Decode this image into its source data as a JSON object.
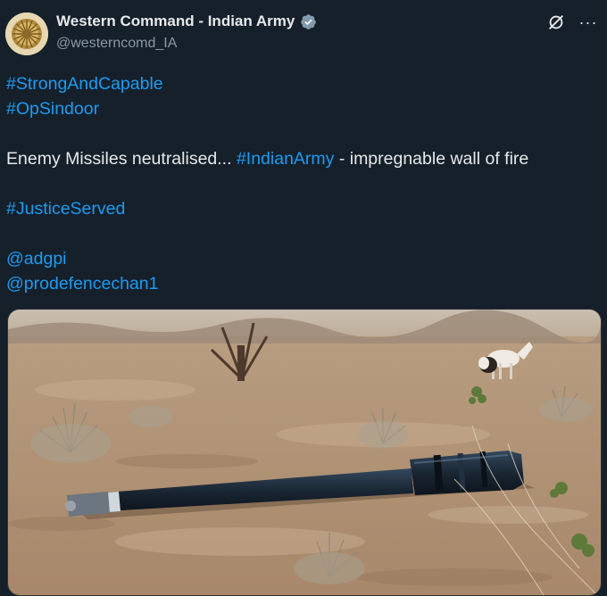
{
  "post": {
    "display_name": "Western Command - Indian Army",
    "handle": "@westerncomd_IA",
    "verified_icon": "verified-badge-icon",
    "hashtag_1": "#StrongAndCapable",
    "hashtag_2": "#OpSindoor",
    "line_prefix": "Enemy Missiles neutralised... ",
    "line_hashtag": "#IndianArmy",
    "line_suffix": " - impregnable wall of fire",
    "hashtag_3": "#JusticeServed",
    "mention_1": "@adgpi",
    "mention_2": "@prodefencechan1",
    "media_alt": "Missile debris lying in desert field with goats in background"
  },
  "actions": {
    "grok_icon": "grok-icon",
    "more_icon": "more-icon",
    "more_label": "···"
  },
  "colors": {
    "background": "#15202b",
    "text": "#e7e9ea",
    "secondary_text": "#8b98a5",
    "link": "#1d9bf0"
  }
}
